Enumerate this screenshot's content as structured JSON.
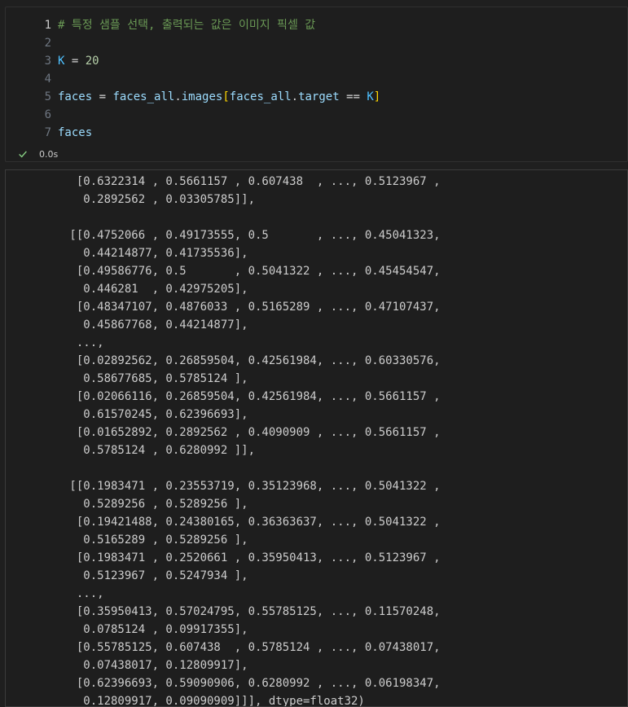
{
  "code_cell": {
    "lines": [
      {
        "num": "1",
        "active": true,
        "tokens": [
          {
            "t": "# 특정 샘플 선택, 출력되는 값은 이미지 픽셀 값",
            "c": "comment"
          }
        ]
      },
      {
        "num": "2",
        "active": false,
        "tokens": []
      },
      {
        "num": "3",
        "active": false,
        "tokens": [
          {
            "t": "K",
            "c": "const"
          },
          {
            "t": " = ",
            "c": "op"
          },
          {
            "t": "20",
            "c": "num"
          }
        ]
      },
      {
        "num": "4",
        "active": false,
        "tokens": []
      },
      {
        "num": "5",
        "active": false,
        "tokens": [
          {
            "t": "faces",
            "c": "var"
          },
          {
            "t": " = ",
            "c": "op"
          },
          {
            "t": "faces_all",
            "c": "var"
          },
          {
            "t": ".",
            "c": "op"
          },
          {
            "t": "images",
            "c": "var"
          },
          {
            "t": "[",
            "c": "bracket"
          },
          {
            "t": "faces_all",
            "c": "var"
          },
          {
            "t": ".",
            "c": "op"
          },
          {
            "t": "target",
            "c": "var"
          },
          {
            "t": " == ",
            "c": "op"
          },
          {
            "t": "K",
            "c": "const"
          },
          {
            "t": "]",
            "c": "bracket"
          }
        ]
      },
      {
        "num": "6",
        "active": false,
        "tokens": []
      },
      {
        "num": "7",
        "active": false,
        "tokens": [
          {
            "t": "faces",
            "c": "var"
          }
        ]
      }
    ],
    "status": {
      "icon": "check-icon",
      "time": "0.0s",
      "icon_color": "#89d185"
    }
  },
  "output": {
    "lines": [
      "  [0.6322314 , 0.5661157 , 0.607438  , ..., 0.5123967 ,",
      "   0.2892562 , 0.03305785]],",
      "",
      " [[0.4752066 , 0.49173555, 0.5       , ..., 0.45041323,",
      "   0.44214877, 0.41735536],",
      "  [0.49586776, 0.5       , 0.5041322 , ..., 0.45454547,",
      "   0.446281  , 0.42975205],",
      "  [0.48347107, 0.4876033 , 0.5165289 , ..., 0.47107437,",
      "   0.45867768, 0.44214877],",
      "  ...,",
      "  [0.02892562, 0.26859504, 0.42561984, ..., 0.60330576,",
      "   0.58677685, 0.5785124 ],",
      "  [0.02066116, 0.26859504, 0.42561984, ..., 0.5661157 ,",
      "   0.61570245, 0.62396693],",
      "  [0.01652892, 0.2892562 , 0.4090909 , ..., 0.5661157 ,",
      "   0.5785124 , 0.6280992 ]],",
      "",
      " [[0.1983471 , 0.23553719, 0.35123968, ..., 0.5041322 ,",
      "   0.5289256 , 0.5289256 ],",
      "  [0.19421488, 0.24380165, 0.36363637, ..., 0.5041322 ,",
      "   0.5165289 , 0.5289256 ],",
      "  [0.1983471 , 0.2520661 , 0.35950413, ..., 0.5123967 ,",
      "   0.5123967 , 0.5247934 ],",
      "  ...,",
      "  [0.35950413, 0.57024795, 0.55785125, ..., 0.11570248,",
      "   0.0785124 , 0.09917355],",
      "  [0.55785125, 0.607438  , 0.5785124 , ..., 0.07438017,",
      "   0.07438017, 0.12809917],",
      "  [0.62396693, 0.59090906, 0.6280992 , ..., 0.06198347,",
      "   0.12809917, 0.09090909]]], dtype=float32)"
    ]
  },
  "colors": {
    "comment": "#6a9955",
    "variable": "#9cdcfe",
    "constant": "#4fc1ff",
    "number": "#b5cea8",
    "bracket": "#ffd700",
    "output_text": "#cccccc"
  }
}
